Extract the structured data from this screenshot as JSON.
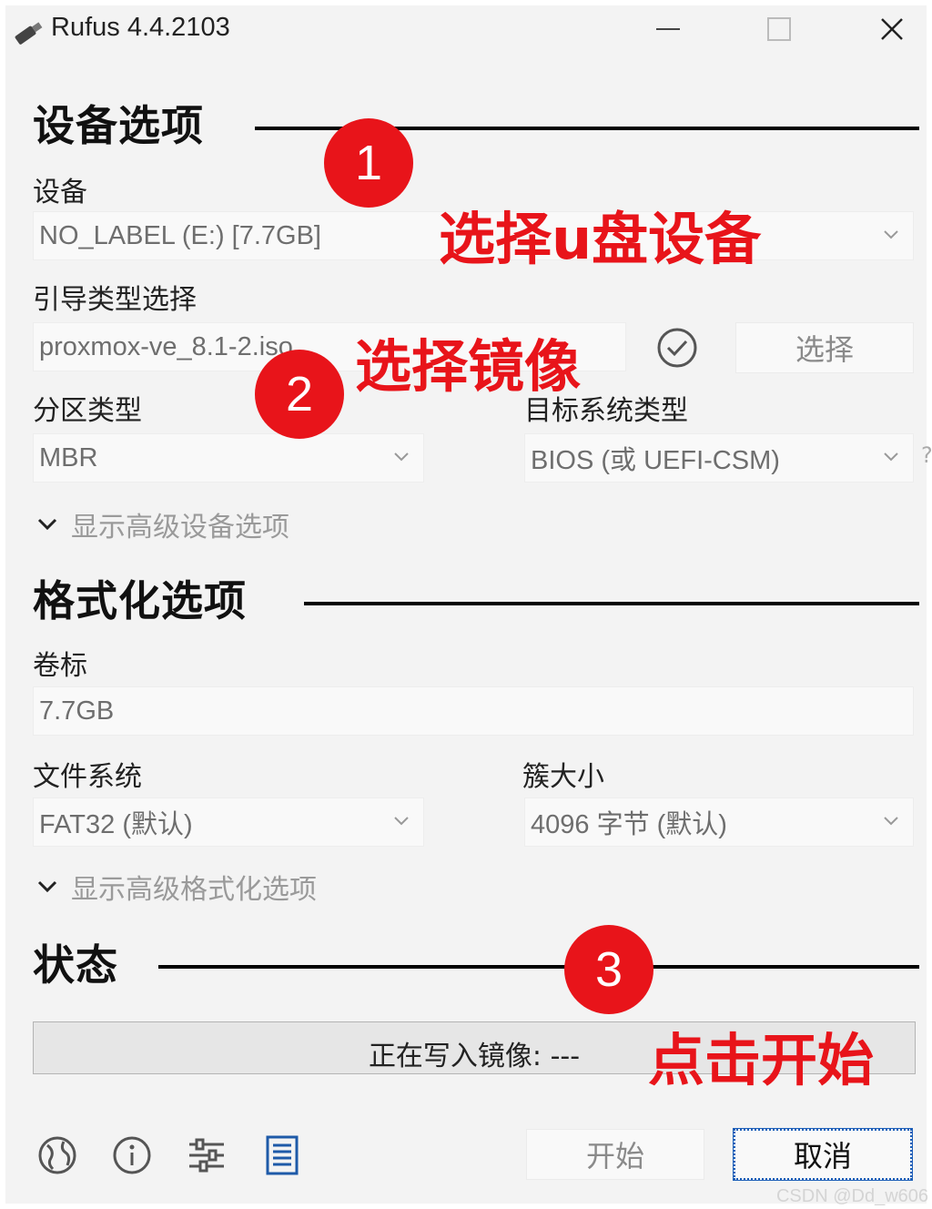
{
  "window": {
    "title": "Rufus 4.4.2103",
    "controls": [
      "minimize-icon",
      "maximize-icon",
      "close-icon"
    ]
  },
  "device_section": {
    "title": "设备选项",
    "device_label": "设备",
    "device_value": "NO_LABEL (E:) [7.7GB]",
    "boot_label": "引导类型选择",
    "boot_value": "proxmox-ve_8.1-2.iso",
    "select_button": "选择",
    "partition_label": "分区类型",
    "partition_value": "MBR",
    "target_label": "目标系统类型",
    "target_value": "BIOS (或 UEFI-CSM)",
    "target_help": "?",
    "advanced_toggle": "显示高级设备选项"
  },
  "format_section": {
    "title": "格式化选项",
    "volume_label": "卷标",
    "volume_value": "7.7GB",
    "fs_label": "文件系统",
    "fs_value": "FAT32 (默认)",
    "cluster_label": "簇大小",
    "cluster_value": "4096 字节 (默认)",
    "advanced_toggle": "显示高级格式化选项"
  },
  "status_section": {
    "title": "状态",
    "progress_text": "正在写入镜像: ---"
  },
  "toolbar": {
    "icons": [
      "globe-icon",
      "info-icon",
      "settings-sliders-icon",
      "log-icon"
    ],
    "start_button": "开始",
    "cancel_button": "取消"
  },
  "annotations": {
    "step1_number": "1",
    "step1_text": "选择u盘设备",
    "step2_number": "2",
    "step2_text": "选择镜像",
    "step3_number": "3",
    "step3_text": "点击开始",
    "color": "#e8141a"
  },
  "watermark": "CSDN @Dd_w606"
}
